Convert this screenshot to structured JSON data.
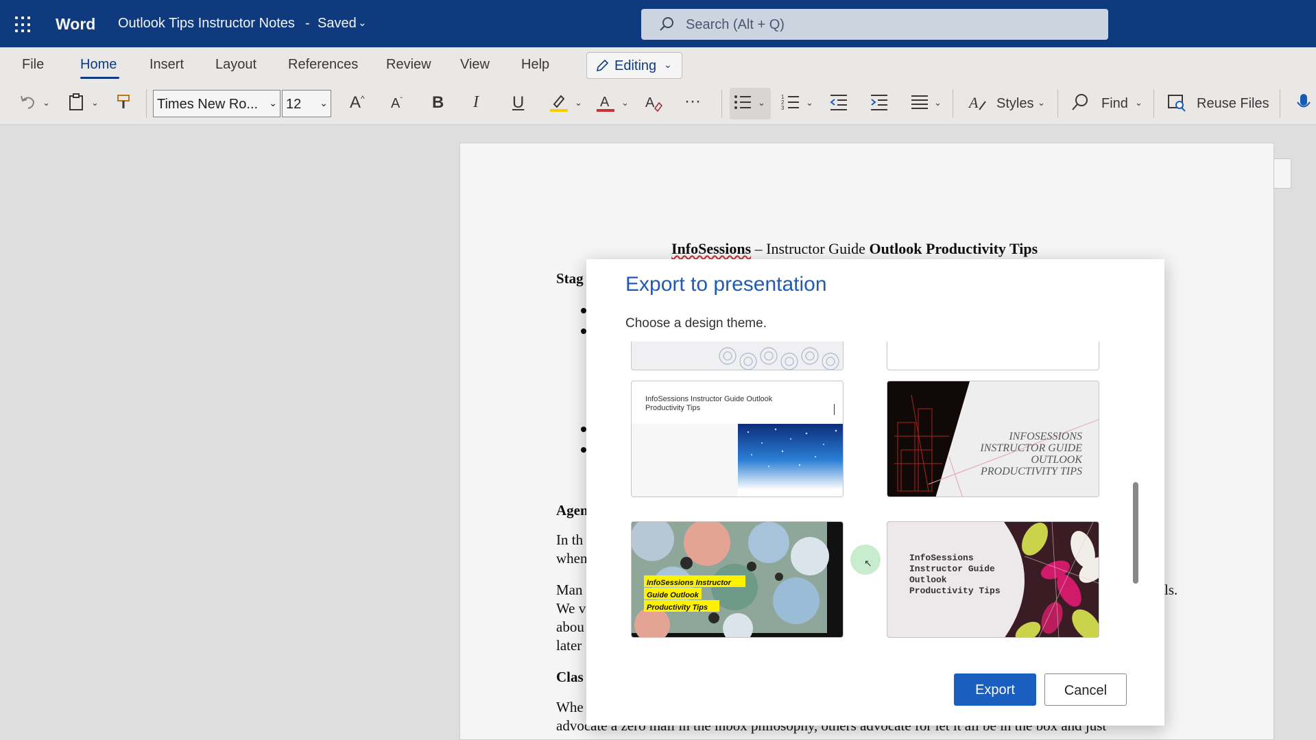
{
  "titlebar": {
    "app_name": "Word",
    "doc_title": "Outlook Tips Instructor Notes",
    "separator": "-",
    "save_status": "Saved",
    "search_placeholder": "Search (Alt + Q)"
  },
  "menu": {
    "tabs": [
      "File",
      "Home",
      "Insert",
      "Layout",
      "References",
      "Review",
      "View",
      "Help"
    ],
    "active_tab": "Home",
    "editing_label": "Editing"
  },
  "toolbar": {
    "font_name": "Times New Ro...",
    "font_size": "12",
    "styles_label": "Styles",
    "find_label": "Find",
    "reuse_label": "Reuse Files"
  },
  "document": {
    "heading_part1": "InfoSessions",
    "heading_dash": " – Instructor Guide ",
    "heading_part2": "Outlook Productivity Tips",
    "frag_stag": "Stag",
    "frag_agen": "Agen",
    "frag_inth": "In th",
    "frag_when": "when",
    "frag_man": "Man",
    "frag_wev": "We v",
    "frag_abou": "abou",
    "frag_later": "later",
    "frag_ls": "ls.",
    "frag_clas": "Clas",
    "frag_whe": "Whe",
    "frag_last": "advocate a zero mail in the inbox philosophy, others advocate for let it all be in the box and just"
  },
  "dialog": {
    "title": "Export to presentation",
    "subtitle": "Choose a design theme.",
    "export_label": "Export",
    "cancel_label": "Cancel",
    "theme_texts": {
      "blue_title": "InfoSessions  Instructor Guide Outlook Productivity Tips",
      "dark_title_l1": "INFOSESSIONS",
      "dark_title_l2": "INSTRUCTOR GUIDE",
      "dark_title_l3": "OUTLOOK",
      "dark_title_l4": "PRODUCTIVITY TIPS",
      "floral_title_l1": "InfoSessions  Instructor",
      "floral_title_l2": "Guide Outlook",
      "floral_title_l3": "Productivity Tips",
      "flower_title_l1": "InfoSessions",
      "flower_title_l2": "Instructor Guide",
      "flower_title_l3": "Outlook",
      "flower_title_l4": "Productivity Tips"
    }
  },
  "colors": {
    "titlebar_bg": "#103e84",
    "accent": "#1a5fbf",
    "dialog_title": "#1f5bb5"
  }
}
